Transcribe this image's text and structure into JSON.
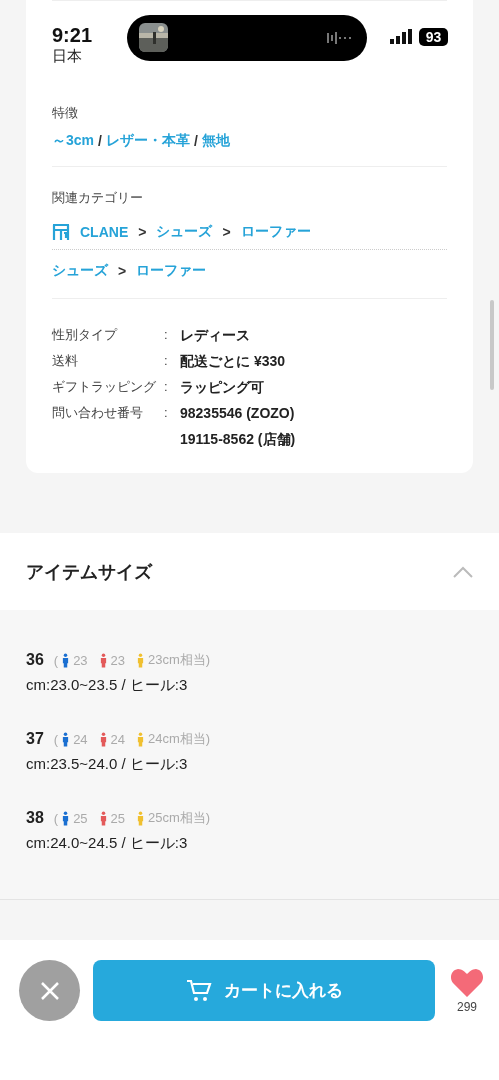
{
  "status_bar": {
    "time": "9:21",
    "battery": "93"
  },
  "details": {
    "origin": {
      "value": "日本"
    },
    "features": {
      "label": "特徴",
      "separator": "/",
      "links": [
        "～3cm",
        "レザー・本革",
        "無地"
      ]
    },
    "related": {
      "label": "関連カテゴリー",
      "paths": [
        {
          "kind": "brand",
          "separator": ">",
          "items": [
            "CLANE",
            "シューズ",
            "ローファー"
          ]
        },
        {
          "kind": "plain",
          "separator": ">",
          "items": [
            "シューズ",
            "ローファー"
          ]
        }
      ]
    },
    "specs": {
      "separator": ":",
      "rows": [
        {
          "label": "性別タイプ",
          "values": [
            "レディース"
          ]
        },
        {
          "label": "送料",
          "values": [
            "配送ごとに ¥330"
          ]
        },
        {
          "label": "ギフトラッピング",
          "values": [
            "ラッピング可"
          ]
        },
        {
          "label": "問い合わせ番号",
          "values": [
            "98235546 (ZOZO)",
            "19115-8562 (店舗)"
          ]
        }
      ]
    }
  },
  "item_sizes": {
    "title": "アイテムサイズ",
    "expanded": true,
    "paren": "(",
    "items": [
      {
        "size": "36",
        "men": "23",
        "women": "23",
        "kids": "23cm相当)",
        "detail": "cm:23.0~23.5 / ヒール:3"
      },
      {
        "size": "37",
        "men": "24",
        "women": "24",
        "kids": "24cm相当)",
        "detail": "cm:23.5~24.0 / ヒール:3"
      },
      {
        "size": "38",
        "men": "25",
        "women": "25",
        "kids": "25cm相当)",
        "detail": "cm:24.0~24.5 / ヒール:3"
      }
    ]
  },
  "bottom_bar": {
    "cart_button": "カートに入れる",
    "favorite_count": "299"
  }
}
